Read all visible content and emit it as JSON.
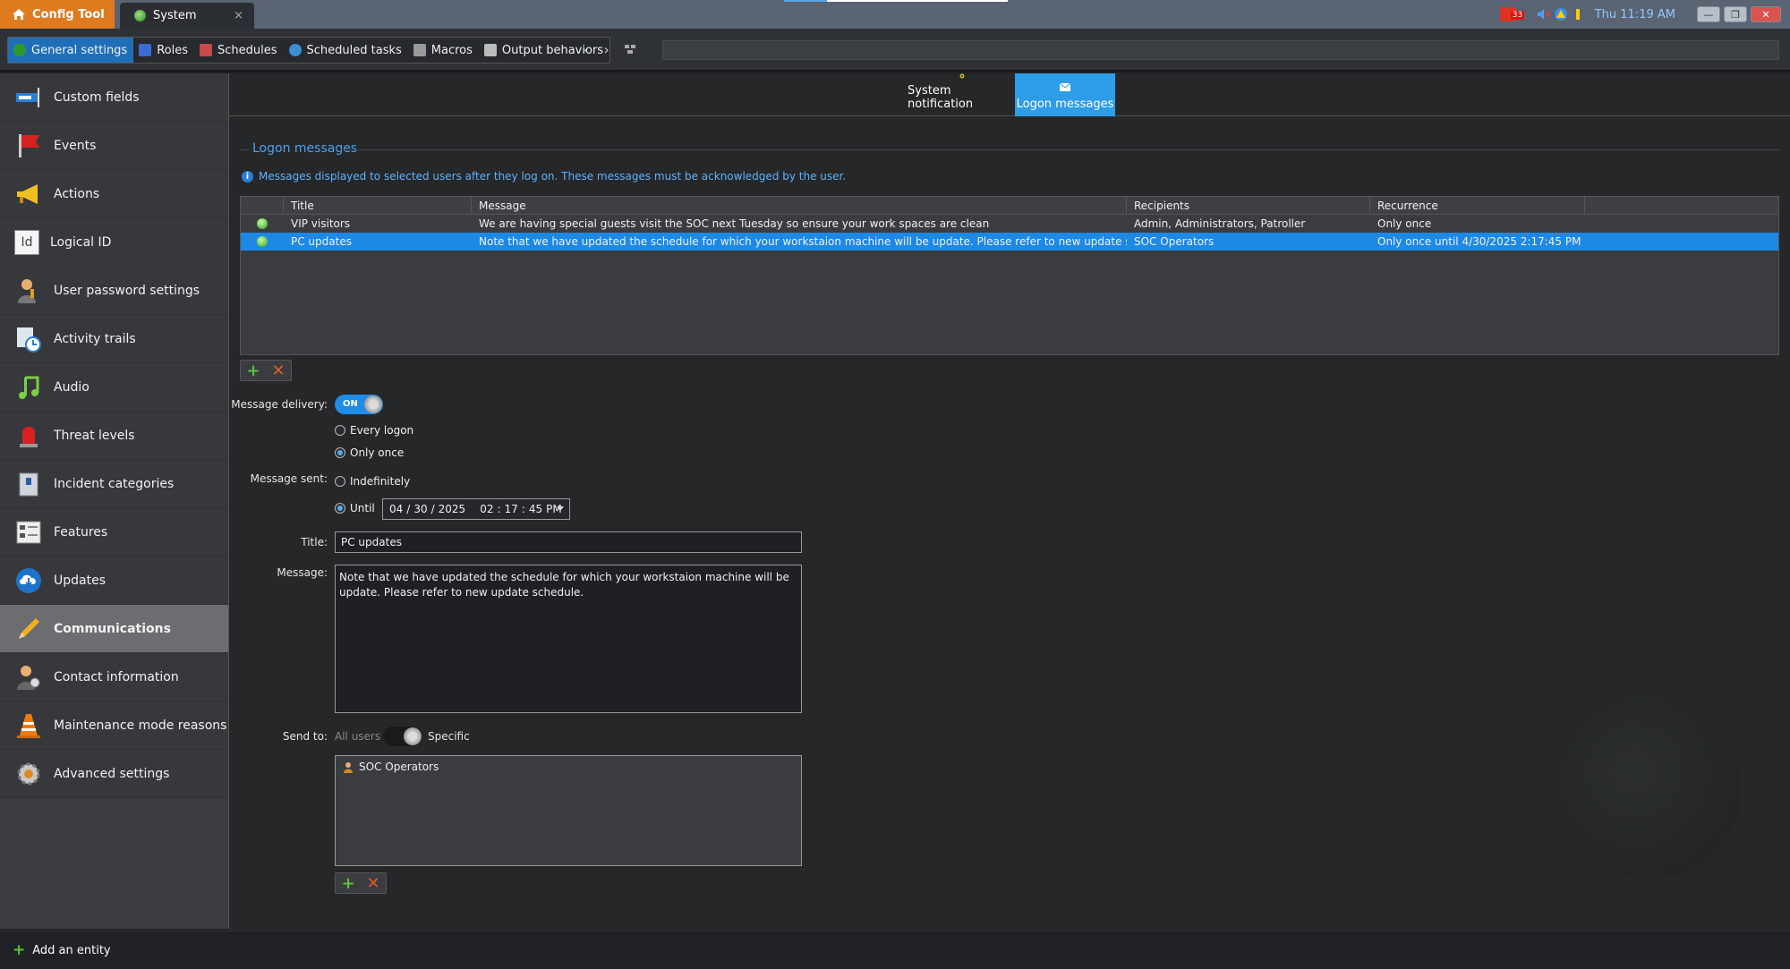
{
  "titlebar": {
    "app_tab": "Config Tool",
    "system_tab": "System",
    "close_glyph": "×",
    "tray_badge": "33",
    "time": "Thu 11:19 AM",
    "minimize_glyph": "—",
    "restore_glyph": "❐",
    "close_window_glyph": "✕"
  },
  "toolbar": {
    "items": [
      {
        "label": "General settings",
        "icon": "globe-icon",
        "color": "#2e9a2e"
      },
      {
        "label": "Roles",
        "icon": "roles-icon",
        "color": "#3a6cd4"
      },
      {
        "label": "Schedules",
        "icon": "calendar-icon",
        "color": "#c94a4a"
      },
      {
        "label": "Scheduled tasks",
        "icon": "scheduled-task-icon",
        "color": "#3a8fd4"
      },
      {
        "label": "Macros",
        "icon": "macro-icon",
        "color": "#aaaaaa"
      },
      {
        "label": "Output behaviors",
        "icon": "output-icon",
        "color": "#cccccc"
      }
    ],
    "back_glyph": "‹",
    "forward_glyph": "›"
  },
  "sidebar": {
    "items": [
      {
        "label": "Custom fields",
        "icon": "custom-fields-icon"
      },
      {
        "label": "Events",
        "icon": "flag-icon"
      },
      {
        "label": "Actions",
        "icon": "megaphone-icon"
      },
      {
        "label": "Logical ID",
        "icon": "id-icon"
      },
      {
        "label": "User password settings",
        "icon": "user-key-icon"
      },
      {
        "label": "Activity trails",
        "icon": "activity-trails-icon"
      },
      {
        "label": "Audio",
        "icon": "music-note-icon"
      },
      {
        "label": "Threat levels",
        "icon": "siren-icon"
      },
      {
        "label": "Incident categories",
        "icon": "incident-icon"
      },
      {
        "label": "Features",
        "icon": "features-icon"
      },
      {
        "label": "Updates",
        "icon": "cloud-download-icon"
      },
      {
        "label": "Communications",
        "icon": "pencil-icon"
      },
      {
        "label": "Contact information",
        "icon": "contact-icon"
      },
      {
        "label": "Maintenance mode reasons",
        "icon": "traffic-cone-icon"
      },
      {
        "label": "Advanced settings",
        "icon": "advanced-gear-icon"
      }
    ],
    "active_index": 11,
    "icon_letters": {
      "id": "Id"
    }
  },
  "subtabs": {
    "system_notification": "System notification",
    "logon_messages": "Logon messages"
  },
  "section": {
    "title": "Logon messages",
    "info_glyph": "i",
    "info": "Messages displayed to selected users after they log on. These messages must be acknowledged by the user."
  },
  "grid": {
    "columns": [
      "Title",
      "Message",
      "Recipients",
      "Recurrence"
    ],
    "rows": [
      {
        "title": "VIP visitors",
        "message": "We are having special guests visit the SOC next Tuesday so ensure your work spaces are clean",
        "recipients": "Admin, Administrators, Patroller",
        "recurrence": "Only once"
      },
      {
        "title": "PC updates",
        "message": "Note that we have updated the schedule for which your workstaion machine will be update. Please refer to new update schedule.",
        "recipients": "SOC Operators",
        "recurrence": "Only once until 4/30/2025 2:17:45 PM"
      }
    ],
    "selected_index": 1
  },
  "buttons": {
    "add_glyph": "+",
    "remove_glyph": "✕"
  },
  "form": {
    "message_delivery_label": "Message delivery:",
    "toggle_on_text": "ON",
    "every_logon": "Every logon",
    "only_once": "Only once",
    "message_sent_label": "Message sent:",
    "indefinitely": "Indefinitely",
    "until": "Until",
    "date": {
      "month": "04",
      "day": "30",
      "year": "2025",
      "hour": "02",
      "minute": "17",
      "second": "45",
      "ampm": "PM",
      "sep_date": "/",
      "sep_time": ":"
    },
    "title_label": "Title:",
    "title_value": "PC updates",
    "message_label": "Message:",
    "message_value": "Note that we have updated the schedule for which your workstaion machine will be update. Please refer to new update schedule.",
    "send_to_label": "Send to:",
    "all_users": "All users",
    "specific": "Specific",
    "recipients": [
      "SOC Operators"
    ]
  },
  "bottombar": {
    "add_entity": "Add an entity"
  },
  "colors": {
    "accent": "#1e88e5",
    "app_tab": "#e07a1f"
  }
}
